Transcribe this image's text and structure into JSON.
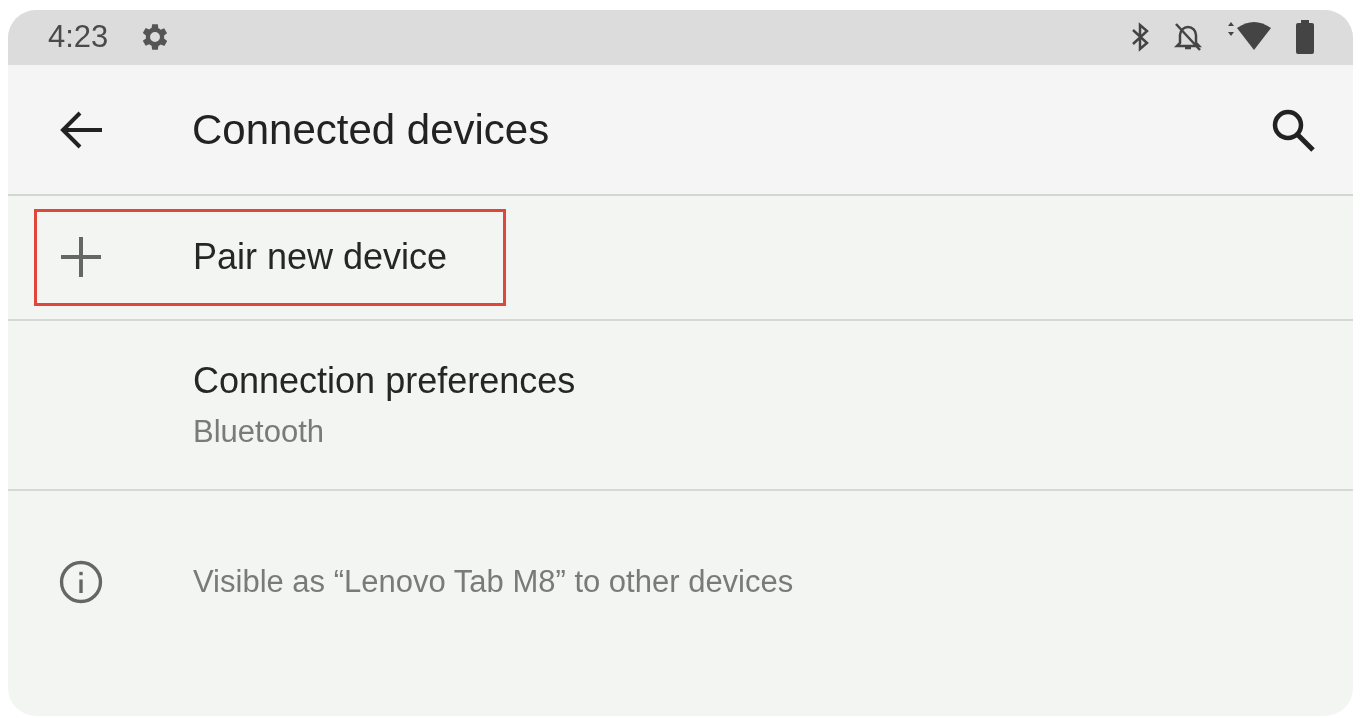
{
  "status_bar": {
    "time": "4:23"
  },
  "app_bar": {
    "title": "Connected devices"
  },
  "items": [
    {
      "kind": "action",
      "title": "Pair new device",
      "highlighted": true
    },
    {
      "kind": "preference",
      "title": "Connection preferences",
      "summary": "Bluetooth",
      "highlighted": false
    },
    {
      "kind": "info",
      "title": "Visible as “Lenovo Tab M8” to other devices",
      "highlighted": false
    }
  ]
}
